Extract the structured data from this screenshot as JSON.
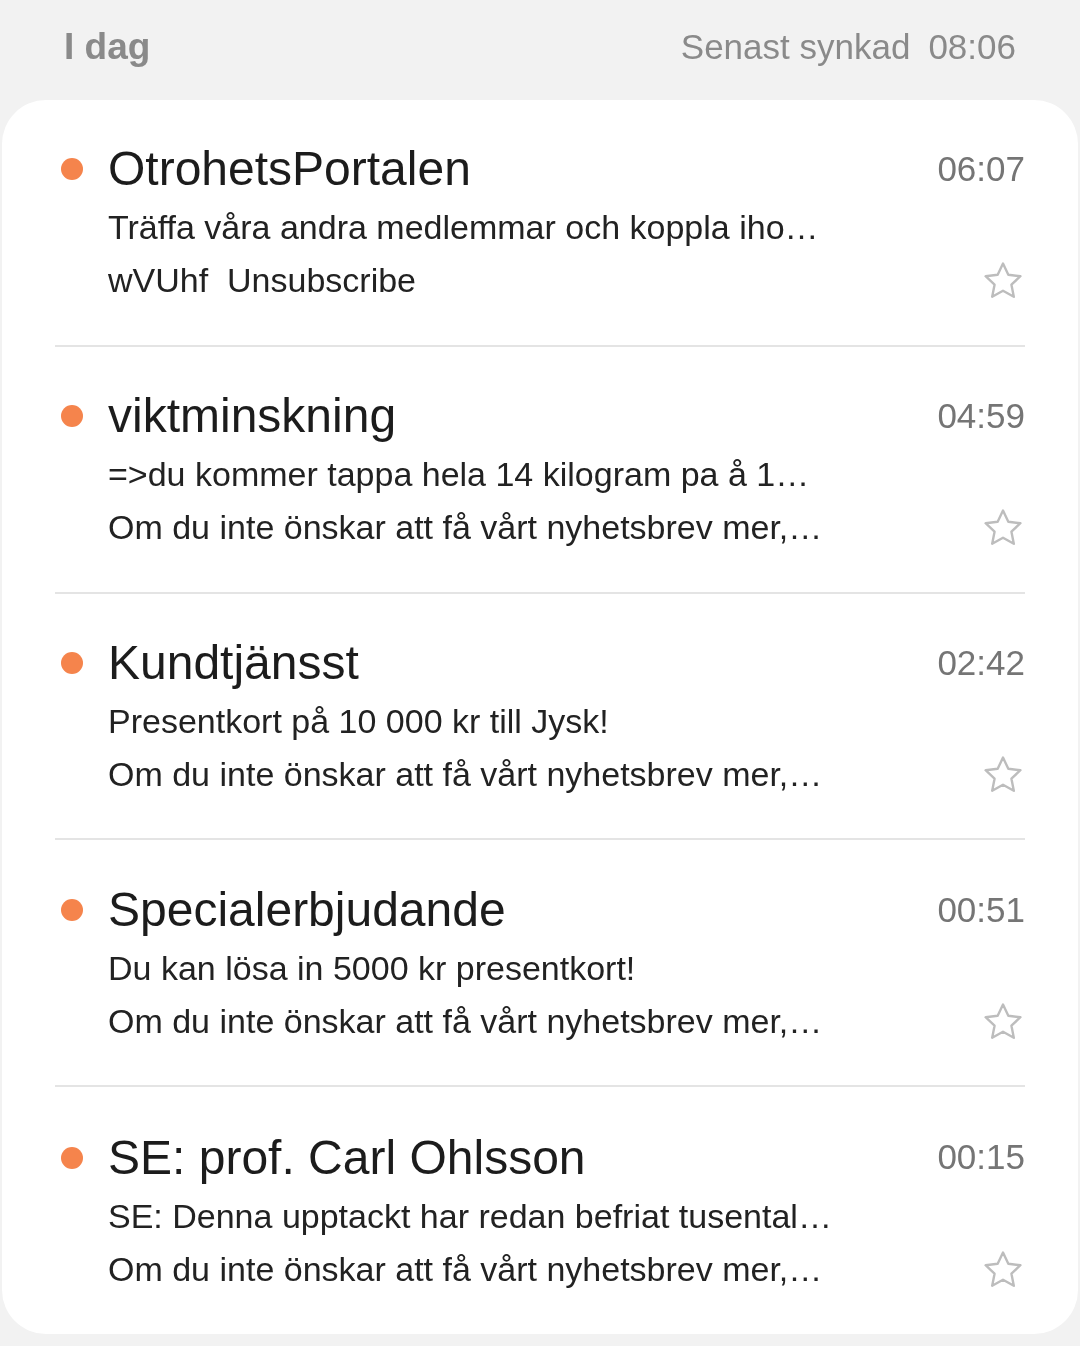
{
  "header": {
    "section": "I dag",
    "sync_label": "Senast synkad",
    "sync_time": "08:06"
  },
  "messages": [
    {
      "sender": "OtrohetsPortalen",
      "time": "06:07",
      "subject": "Träffa våra andra medlemmar och koppla iho…",
      "preview": "wVUhf  Unsubscribe",
      "unread": true,
      "starred": false
    },
    {
      "sender": "viktminskning",
      "time": "04:59",
      "subject": "=>du kommer tappa hela 14 kilogram pa å 1…",
      "preview": "Om du inte önskar att få vårt nyhetsbrev mer,…",
      "unread": true,
      "starred": false
    },
    {
      "sender": "Kundtjänsst",
      "time": "02:42",
      "subject": "Presentkort på 10 000 kr till Jysk!",
      "preview": "Om du inte önskar att få vårt nyhetsbrev mer,…",
      "unread": true,
      "starred": false
    },
    {
      "sender": "Specialerbjudande",
      "time": "00:51",
      "subject": "Du kan lösa in 5000 kr presentkort!",
      "preview": "Om du inte önskar att få vårt nyhetsbrev mer,…",
      "unread": true,
      "starred": false
    },
    {
      "sender": "SE: prof. Carl Ohlsson",
      "time": "00:15",
      "subject": "SE: Denna upptackt har redan befriat tusental…",
      "preview": "Om du inte önskar att få vårt nyhetsbrev mer,…",
      "unread": true,
      "starred": false
    }
  ]
}
